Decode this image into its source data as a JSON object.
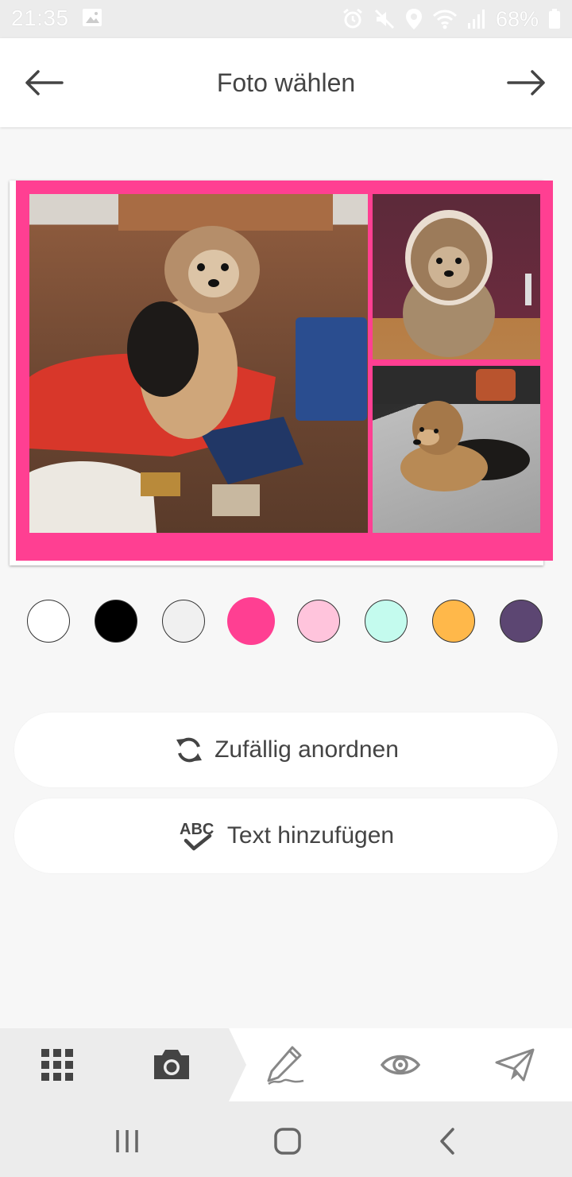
{
  "status_bar": {
    "time": "21:35",
    "battery_percent": "68%",
    "icons": [
      "image-icon",
      "alarm-icon",
      "mute-icon",
      "location-icon",
      "wifi-icon",
      "signal-icon",
      "battery-icon"
    ]
  },
  "header": {
    "title": "Foto wählen",
    "back_icon": "arrow-left-icon",
    "forward_icon": "arrow-right-icon"
  },
  "collage": {
    "frame_color": "#ff3f92",
    "photos": [
      "dog-with-bag-photo",
      "dog-on-cushion-photo",
      "dog-lying-photo"
    ]
  },
  "color_swatches": [
    {
      "name": "white",
      "color": "#ffffff",
      "selected": false
    },
    {
      "name": "black",
      "color": "#000000",
      "selected": false
    },
    {
      "name": "light-gray",
      "color": "#f0f0f0",
      "selected": false
    },
    {
      "name": "pink",
      "color": "#ff3f92",
      "selected": true
    },
    {
      "name": "light-pink",
      "color": "#ffc4dc",
      "selected": false
    },
    {
      "name": "mint",
      "color": "#c4fbee",
      "selected": false
    },
    {
      "name": "orange",
      "color": "#ffb84a",
      "selected": false
    },
    {
      "name": "purple",
      "color": "#5c4672",
      "selected": false
    }
  ],
  "actions": {
    "shuffle_label": "Zufällig anordnen",
    "add_text_label": "Text hinzufügen",
    "abc_icon_text": "ABC"
  },
  "tabs": [
    {
      "icon": "grid-icon",
      "state": "done"
    },
    {
      "icon": "camera-icon",
      "state": "active"
    },
    {
      "icon": "pen-icon",
      "state": "inactive"
    },
    {
      "icon": "eye-icon",
      "state": "inactive"
    },
    {
      "icon": "send-icon",
      "state": "inactive"
    }
  ],
  "nav_bar": [
    "recent-apps-icon",
    "home-icon",
    "back-icon"
  ]
}
